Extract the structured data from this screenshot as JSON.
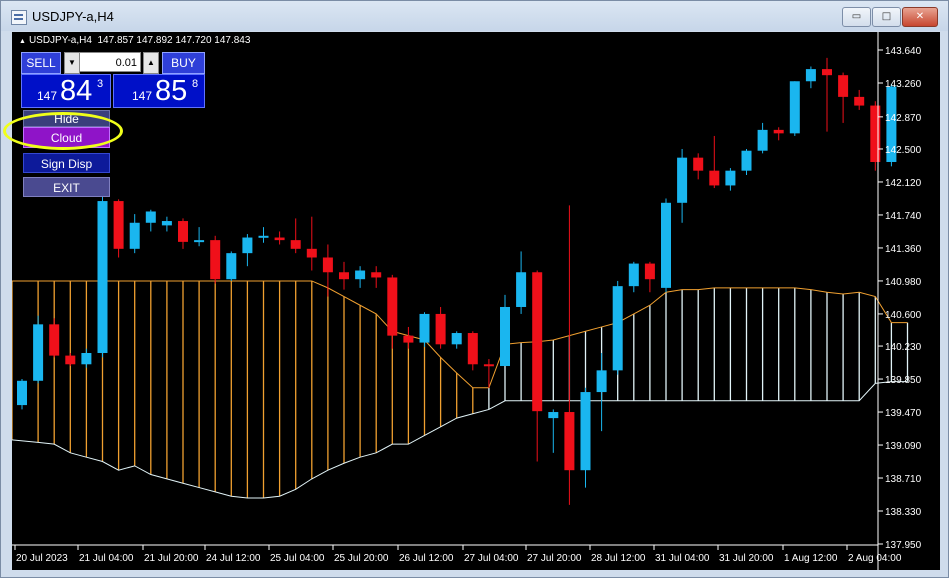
{
  "window": {
    "title": "USDJPY-a,H4",
    "buttons": {
      "minimize": "▭",
      "maximize": "□",
      "close": "✕"
    }
  },
  "info_bar": {
    "symbol_tf": "USDJPY-a,H4",
    "ohlc": "147.857 147.892 147.720 147.843"
  },
  "trade_panel": {
    "sell_label": "SELL",
    "buy_label": "BUY",
    "lot_value": "0.01",
    "lot_down_icon": "▼",
    "lot_up_icon": "▲",
    "sell_price": {
      "prefix": "147",
      "big": "84",
      "sup": "3"
    },
    "buy_price": {
      "prefix": "147",
      "big": "85",
      "sup": "8"
    }
  },
  "menu": {
    "hide": "Hide",
    "cloud": "Cloud",
    "sign_disp": "Sign Disp",
    "exit": "EXIT"
  },
  "colors": {
    "bull": "#1ab6ef",
    "bear": "#f0101a",
    "cloud_bear": "#f0a030",
    "cloud_bull": "#e2f4f8",
    "axis_text": "#ffffff",
    "background": "#000000",
    "highlight": "#f0ff1a"
  },
  "chart_data": {
    "type": "candlestick",
    "symbol": "USDJPY-a",
    "timeframe": "H4",
    "y_axis_labels": [
      "143.640",
      "143.260",
      "142.870",
      "142.500",
      "142.120",
      "141.740",
      "141.360",
      "140.980",
      "140.600",
      "140.230",
      "139.850",
      "139.470",
      "139.090",
      "138.710",
      "138.330",
      "137.950"
    ],
    "ylim": [
      137.95,
      143.64
    ],
    "x_axis_labels": [
      "20 Jul 2023",
      "21 Jul 04:00",
      "21 Jul 20:00",
      "24 Jul 12:00",
      "25 Jul 04:00",
      "25 Jul 20:00",
      "26 Jul 12:00",
      "27 Jul 04:00",
      "27 Jul 20:00",
      "28 Jul 12:00",
      "31 Jul 04:00",
      "31 Jul 20:00",
      "1 Aug 12:00",
      "2 Aug 04:00"
    ],
    "candles": [
      {
        "o": 139.55,
        "h": 139.85,
        "l": 139.5,
        "c": 139.83
      },
      {
        "o": 139.83,
        "h": 140.58,
        "l": 139.8,
        "c": 140.48
      },
      {
        "o": 140.48,
        "h": 140.55,
        "l": 140.1,
        "c": 140.12
      },
      {
        "o": 140.12,
        "h": 140.15,
        "l": 140.0,
        "c": 140.02
      },
      {
        "o": 140.02,
        "h": 140.2,
        "l": 139.98,
        "c": 140.15
      },
      {
        "o": 140.15,
        "h": 142.1,
        "l": 140.1,
        "c": 141.9
      },
      {
        "o": 141.9,
        "h": 141.92,
        "l": 141.25,
        "c": 141.35
      },
      {
        "o": 141.35,
        "h": 141.75,
        "l": 141.3,
        "c": 141.65
      },
      {
        "o": 141.65,
        "h": 141.8,
        "l": 141.55,
        "c": 141.78
      },
      {
        "o": 141.62,
        "h": 141.72,
        "l": 141.55,
        "c": 141.67
      },
      {
        "o": 141.67,
        "h": 141.7,
        "l": 141.35,
        "c": 141.43
      },
      {
        "o": 141.43,
        "h": 141.6,
        "l": 141.38,
        "c": 141.45
      },
      {
        "o": 141.45,
        "h": 141.5,
        "l": 140.95,
        "c": 141.0
      },
      {
        "o": 141.0,
        "h": 141.32,
        "l": 140.98,
        "c": 141.3
      },
      {
        "o": 141.3,
        "h": 141.52,
        "l": 141.15,
        "c": 141.48
      },
      {
        "o": 141.48,
        "h": 141.6,
        "l": 141.42,
        "c": 141.5
      },
      {
        "o": 141.48,
        "h": 141.55,
        "l": 141.4,
        "c": 141.45
      },
      {
        "o": 141.45,
        "h": 141.7,
        "l": 141.3,
        "c": 141.35
      },
      {
        "o": 141.35,
        "h": 141.72,
        "l": 141.1,
        "c": 141.25
      },
      {
        "o": 141.25,
        "h": 141.4,
        "l": 140.8,
        "c": 141.08
      },
      {
        "o": 141.08,
        "h": 141.2,
        "l": 140.88,
        "c": 141.0
      },
      {
        "o": 141.0,
        "h": 141.15,
        "l": 140.9,
        "c": 141.1
      },
      {
        "o": 141.08,
        "h": 141.15,
        "l": 140.9,
        "c": 141.02
      },
      {
        "o": 141.02,
        "h": 141.05,
        "l": 140.2,
        "c": 140.35
      },
      {
        "o": 140.35,
        "h": 140.45,
        "l": 140.2,
        "c": 140.27
      },
      {
        "o": 140.27,
        "h": 140.62,
        "l": 140.22,
        "c": 140.6
      },
      {
        "o": 140.6,
        "h": 140.68,
        "l": 140.2,
        "c": 140.25
      },
      {
        "o": 140.25,
        "h": 140.4,
        "l": 140.2,
        "c": 140.38
      },
      {
        "o": 140.38,
        "h": 140.4,
        "l": 139.95,
        "c": 140.02
      },
      {
        "o": 140.02,
        "h": 140.08,
        "l": 139.75,
        "c": 140.0
      },
      {
        "o": 140.0,
        "h": 140.82,
        "l": 140.0,
        "c": 140.68
      },
      {
        "o": 140.68,
        "h": 141.32,
        "l": 140.6,
        "c": 141.08
      },
      {
        "o": 141.08,
        "h": 141.1,
        "l": 138.9,
        "c": 139.48
      },
      {
        "o": 139.4,
        "h": 139.5,
        "l": 139.0,
        "c": 139.47
      },
      {
        "o": 139.47,
        "h": 141.85,
        "l": 138.4,
        "c": 138.8
      },
      {
        "o": 138.8,
        "h": 139.75,
        "l": 138.6,
        "c": 139.7
      },
      {
        "o": 139.7,
        "h": 140.15,
        "l": 139.25,
        "c": 139.95
      },
      {
        "o": 139.95,
        "h": 140.98,
        "l": 139.9,
        "c": 140.92
      },
      {
        "o": 140.92,
        "h": 141.2,
        "l": 140.85,
        "c": 141.18
      },
      {
        "o": 141.18,
        "h": 141.2,
        "l": 140.85,
        "c": 141.0
      },
      {
        "o": 140.9,
        "h": 141.93,
        "l": 140.85,
        "c": 141.88
      },
      {
        "o": 141.88,
        "h": 142.5,
        "l": 141.65,
        "c": 142.4
      },
      {
        "o": 142.4,
        "h": 142.45,
        "l": 142.15,
        "c": 142.25
      },
      {
        "o": 142.25,
        "h": 142.65,
        "l": 142.05,
        "c": 142.08
      },
      {
        "o": 142.08,
        "h": 142.28,
        "l": 142.02,
        "c": 142.25
      },
      {
        "o": 142.25,
        "h": 142.5,
        "l": 142.2,
        "c": 142.48
      },
      {
        "o": 142.48,
        "h": 142.8,
        "l": 142.45,
        "c": 142.72
      },
      {
        "o": 142.72,
        "h": 142.75,
        "l": 142.6,
        "c": 142.68
      },
      {
        "o": 142.68,
        "h": 143.28,
        "l": 142.65,
        "c": 143.28
      },
      {
        "o": 143.28,
        "h": 143.45,
        "l": 143.2,
        "c": 143.42
      },
      {
        "o": 143.42,
        "h": 143.55,
        "l": 142.7,
        "c": 143.35
      },
      {
        "o": 143.35,
        "h": 143.38,
        "l": 142.8,
        "c": 143.1
      },
      {
        "o": 143.1,
        "h": 143.18,
        "l": 142.95,
        "c": 143.0
      },
      {
        "o": 143.0,
        "h": 143.05,
        "l": 142.25,
        "c": 142.35
      },
      {
        "o": 142.35,
        "h": 143.25,
        "l": 142.3,
        "c": 143.22
      }
    ],
    "ichimoku_cloud": {
      "span_upper": [
        140.98,
        140.98,
        140.98,
        140.98,
        140.98,
        140.98,
        140.98,
        140.98,
        140.98,
        140.98,
        140.98,
        140.98,
        140.98,
        140.98,
        140.98,
        140.98,
        140.98,
        140.98,
        140.98,
        140.9,
        140.8,
        140.7,
        140.6,
        140.4,
        140.35,
        140.3,
        140.1,
        139.92,
        139.75,
        139.75,
        140.25,
        140.27,
        140.28,
        140.3,
        140.35,
        140.4,
        140.45,
        140.5,
        140.6,
        140.7,
        140.85,
        140.88,
        140.88,
        140.9,
        140.9,
        140.9,
        140.9,
        140.9,
        140.9,
        140.88,
        140.85,
        140.83,
        140.85,
        140.8,
        140.5,
        140.5
      ],
      "span_lower": [
        139.15,
        139.12,
        139.1,
        139.0,
        138.95,
        138.9,
        138.8,
        138.85,
        138.75,
        138.7,
        138.65,
        138.6,
        138.55,
        138.5,
        138.48,
        138.48,
        138.5,
        138.58,
        138.7,
        138.8,
        138.88,
        138.95,
        139.0,
        139.1,
        139.1,
        139.2,
        139.3,
        139.4,
        139.45,
        139.5,
        139.6,
        139.6,
        139.6,
        139.6,
        139.6,
        139.6,
        139.6,
        139.6,
        139.6,
        139.6,
        139.6,
        139.6,
        139.6,
        139.6,
        139.6,
        139.6,
        139.6,
        139.6,
        139.6,
        139.6,
        139.6,
        139.6,
        139.6,
        139.8,
        139.82,
        139.82
      ],
      "bull_from_index": 29
    }
  }
}
